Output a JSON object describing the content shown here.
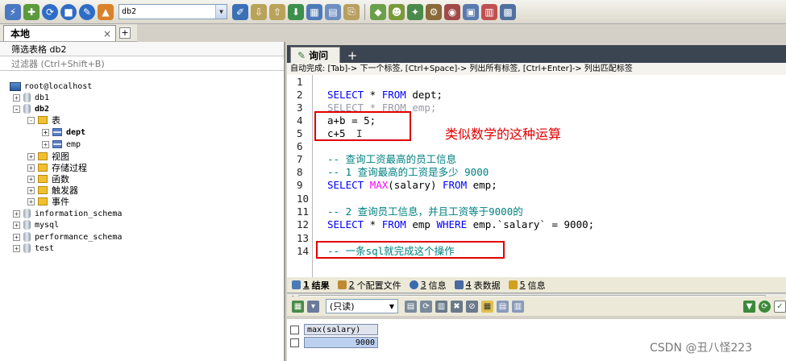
{
  "toolbar": {
    "db_select_value": "db2",
    "icons": [
      "connect-icon",
      "new-connection-icon",
      "refresh-icon",
      "stop-icon",
      "tools-icon",
      "schema-icon",
      "query-icon",
      "import-icon",
      "export-icon",
      "backup-icon",
      "table-icon",
      "grid-icon",
      "restore-icon",
      "sync-icon",
      "user-icon",
      "schedule-icon",
      "monitor-icon",
      "analyzer-icon",
      "report-icon"
    ]
  },
  "left": {
    "tab_label": "本地",
    "tab_close": "×",
    "add_tab": "+",
    "filter_label": "筛选表格 db2",
    "filter_hint": "过滤器 (Ctrl+Shift+B)",
    "tree": {
      "root": "root@localhost",
      "db1": "db1",
      "db2": "db2",
      "tables_folder": "表",
      "table_dept": "dept",
      "table_emp": "emp",
      "views": "视图",
      "procedures": "存储过程",
      "functions": "函数",
      "triggers": "触发器",
      "events": "事件",
      "information_schema": "information_schema",
      "mysql": "mysql",
      "performance_schema": "performance_schema",
      "test": "test",
      "expand_plus": "+",
      "expand_minus": "-"
    }
  },
  "query": {
    "tab_label": "询问",
    "add_tab": "+",
    "autocomplete_hint": "自动完成: [Tab]-> 下一个标签, [Ctrl+Space]-> 列出所有标签, [Ctrl+Enter]-> 列出匹配标签",
    "line_numbers": [
      "1",
      "2",
      "3",
      "4",
      "5",
      "6",
      "7",
      "8",
      "9",
      "10",
      "11",
      "12",
      "13",
      "14"
    ],
    "lines": {
      "l2_kw1": "SELECT",
      "l2_rest1": " * ",
      "l2_kw2": "FROM",
      "l2_rest2": " dept;",
      "l3": "SELECT * FROM emp;",
      "l4": "a+b = 5;",
      "l5": "c+5",
      "l7": "-- 查询工资最高的员工信息",
      "l8": "-- 1 查询最高的工资是多少 9000",
      "l9_kw1": "SELECT",
      "l9_fn": "MAX",
      "l9_rest1": "(salary) ",
      "l9_kw2": "FROM",
      "l9_rest2": " emp;",
      "l11": "-- 2 查询员工信息，并且工资等于9000的",
      "l12_kw1": "SELECT",
      "l12_rest1": " * ",
      "l12_kw2": "FROM",
      "l12_rest2": " emp ",
      "l12_kw3": "WHERE",
      "l12_rest3": " emp.`salary` = 9000;",
      "l14": "-- 一条sql就完成这个操作"
    },
    "annotation": "类似数学的这种运算"
  },
  "results": {
    "tabs": [
      {
        "num": "1",
        "label": "结果"
      },
      {
        "num": "2",
        "label": "个配置文件"
      },
      {
        "num": "3",
        "label": "信息"
      },
      {
        "num": "4",
        "label": "表数据"
      },
      {
        "num": "5",
        "label": "信息"
      }
    ],
    "readonly_select": "(只读)",
    "grid": {
      "column": "max(salary)",
      "value": "9000"
    }
  },
  "watermark": "CSDN @丑八怪223",
  "colors": {
    "keyword": "#0000ff",
    "function": "#ff00ff",
    "comment": "#008080",
    "highlight_box": "#e00000"
  }
}
